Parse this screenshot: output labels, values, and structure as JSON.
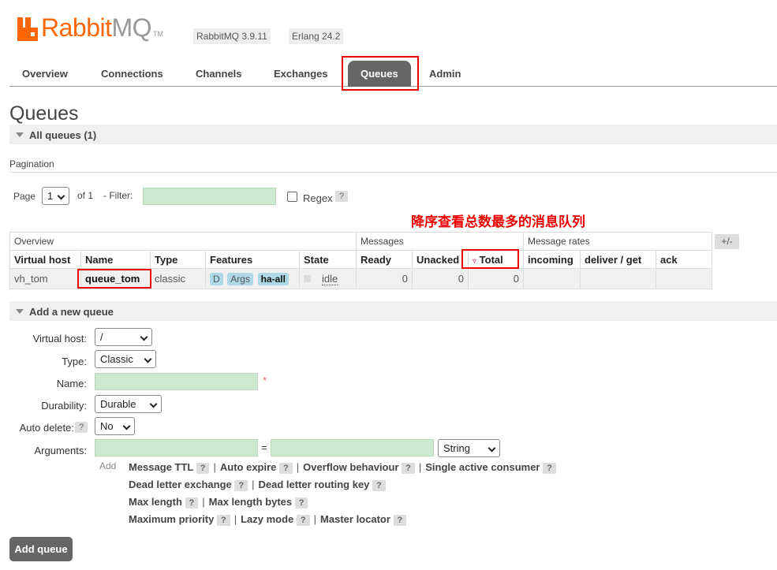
{
  "header": {
    "logo_brand": "Rabbit",
    "logo_brand2": "MQ",
    "logo_tm": "TM",
    "rabbitmq_version": "RabbitMQ 3.9.11",
    "erlang_version": "Erlang 24.2"
  },
  "tabs": [
    {
      "label": "Overview"
    },
    {
      "label": "Connections"
    },
    {
      "label": "Channels"
    },
    {
      "label": "Exchanges"
    },
    {
      "label": "Queues"
    },
    {
      "label": "Admin"
    }
  ],
  "page_title": "Queues",
  "all_queues": "All queues (1)",
  "pagination": {
    "title": "Pagination",
    "page_label": "Page",
    "page_value": "1",
    "of_label": "of 1",
    "filter_label": "- Filter:",
    "filter_value": "",
    "regex_label": "Regex",
    "help": "?"
  },
  "annotation": "降序查看总数最多的消息队列",
  "table": {
    "group_headers": [
      "Overview",
      "Messages",
      "Message rates"
    ],
    "plus_minus": "+/-",
    "columns": [
      "Virtual host",
      "Name",
      "Type",
      "Features",
      "State",
      "Ready",
      "Unacked",
      "Total",
      "incoming",
      "deliver / get",
      "ack"
    ],
    "sort_indicator": "▿",
    "rows": [
      {
        "vhost": "vh_tom",
        "name": "queue_tom",
        "type": "classic",
        "features": [
          "D",
          "Args",
          "ha-all"
        ],
        "state": "idle",
        "ready": "0",
        "unacked": "0",
        "total": "0",
        "incoming": "",
        "deliver_get": "",
        "ack": ""
      }
    ]
  },
  "add_queue": {
    "section_title": "Add a new queue",
    "virtual_host_label": "Virtual host:",
    "virtual_host_value": "/",
    "type_label": "Type:",
    "type_value": "Classic",
    "name_label": "Name:",
    "name_value": "",
    "required_mark": "*",
    "durability_label": "Durability:",
    "durability_value": "Durable",
    "auto_delete_label": "Auto delete:",
    "auto_delete_value": "No",
    "arguments_label": "Arguments:",
    "equals": "=",
    "arg_type_value": "String",
    "add_label": "Add",
    "arg_links": [
      [
        "Message TTL",
        "Auto expire",
        "Overflow behaviour",
        "Single active consumer"
      ],
      [
        "Dead letter exchange",
        "Dead letter routing key"
      ],
      [
        "Max length",
        "Max length bytes"
      ],
      [
        "Maximum priority",
        "Lazy mode",
        "Master locator"
      ]
    ],
    "submit_label": "Add queue"
  }
}
